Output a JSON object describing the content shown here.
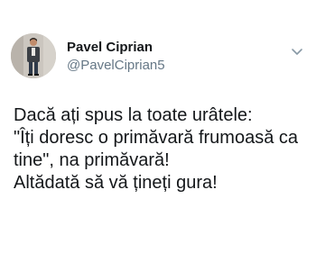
{
  "author": {
    "name": "Pavel Ciprian",
    "handle": "@PavelCiprian5"
  },
  "menu": {
    "icon": "chevron-down-icon"
  },
  "tweet": {
    "lines": [
      "Dacă ați spus la toate urâtele:",
      "\"Îți doresc o primăvară frumoasă ca",
      "tine\", na primăvară!",
      "Altădată să vă țineți gura!"
    ]
  },
  "colors": {
    "text": "#14171a",
    "secondary": "#657786",
    "background": "#ffffff"
  }
}
